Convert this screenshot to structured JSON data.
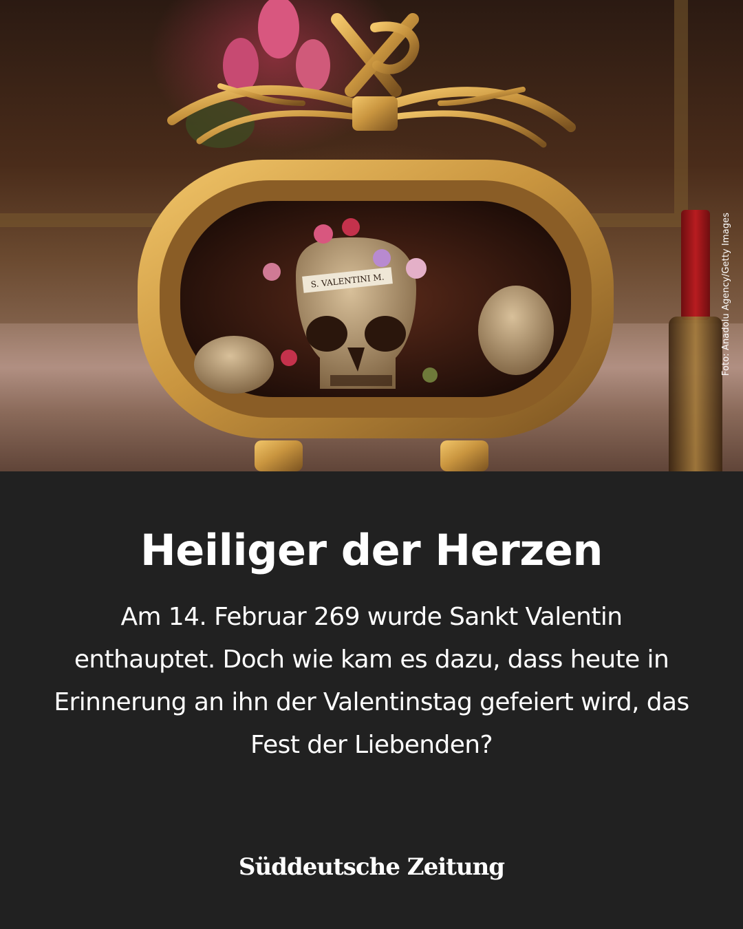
{
  "photo": {
    "alt": "",
    "credit": "Foto: Anadolu Agency/Getty Images",
    "reliquary_label": "S. VALENTINI M."
  },
  "headline": "Heiliger der Herzen",
  "body": "Am 14. Februar 269 wurde Sankt Valentin enthauptet. Doch wie kam es dazu, dass heute in Erinnerung an ihn der Valentinstag gefeiert wird, das Fest der Liebenden?",
  "brand": {
    "logo_text": "Süddeutsche Zeitung"
  },
  "colors": {
    "background": "#212121",
    "text": "#ffffff",
    "gold": "#c9953f"
  }
}
